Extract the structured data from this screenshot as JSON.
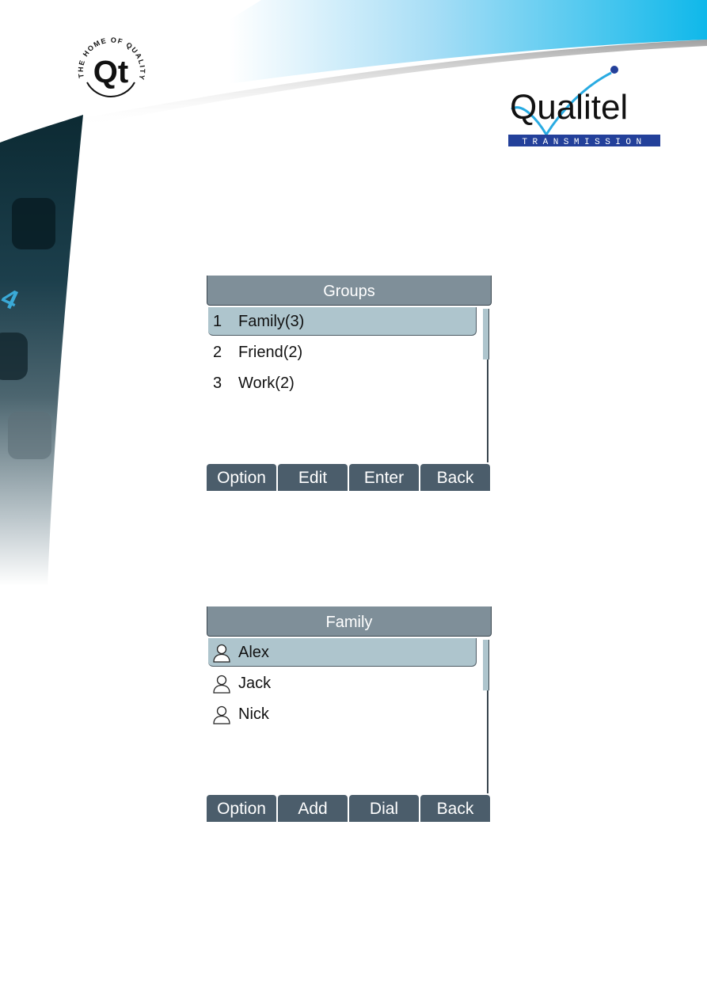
{
  "brand": {
    "qt_logo_text": "Qt",
    "qt_logo_ring_text": "THE HOME OF QUALITY",
    "company_name": "Qualitel",
    "company_tagline": "TRANSMISSION",
    "colors": {
      "banner_blue": "#10b9ec",
      "logo_navy": "#23409a",
      "logo_cyan": "#29abe2"
    }
  },
  "screens": [
    {
      "title": "Groups",
      "items": [
        {
          "num": "1",
          "label": "Family(3)",
          "selected": true
        },
        {
          "num": "2",
          "label": "Friend(2)",
          "selected": false
        },
        {
          "num": "3",
          "label": "Work(2)",
          "selected": false
        }
      ],
      "softkeys": [
        "Option",
        "Edit",
        "Enter",
        "Back"
      ]
    },
    {
      "title": "Family",
      "items": [
        {
          "icon": "person-icon",
          "label": "Alex",
          "selected": true
        },
        {
          "icon": "person-icon",
          "label": "Jack",
          "selected": false
        },
        {
          "icon": "person-icon",
          "label": "Nick",
          "selected": false
        }
      ],
      "softkeys": [
        "Option",
        "Add",
        "Dial",
        "Back"
      ]
    }
  ],
  "colors": {
    "title_bar": "#7f8f99",
    "selection": "#aec5cd",
    "softkey": "#4b5d6b"
  }
}
